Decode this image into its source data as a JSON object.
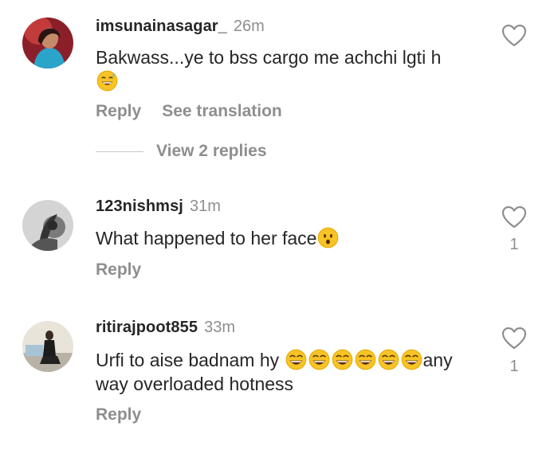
{
  "comments": [
    {
      "username": "imsunainasagar_",
      "time": "26m",
      "text_before": "Bakwass...ye to bss cargo me achchi lgti h",
      "emoji_line": "😅",
      "reply_label": "Reply",
      "translation_label": "See translation",
      "view_replies_label": "View 2 replies",
      "likes": ""
    },
    {
      "username": "123nishmsj",
      "time": "31m",
      "text": "What happened to her face",
      "emoji": "😯",
      "reply_label": "Reply",
      "likes": "1"
    },
    {
      "username": "ritirajpoot855",
      "time": "33m",
      "text_a": "Urfi to aise badnam hy ",
      "emojis": "😂😂😂😂😂😂",
      "text_b": "any way  overloaded hotness",
      "reply_label": "Reply",
      "likes": "1"
    }
  ],
  "icons": {
    "like": "heart-outline-icon",
    "emoji_color": "#f7c325"
  }
}
